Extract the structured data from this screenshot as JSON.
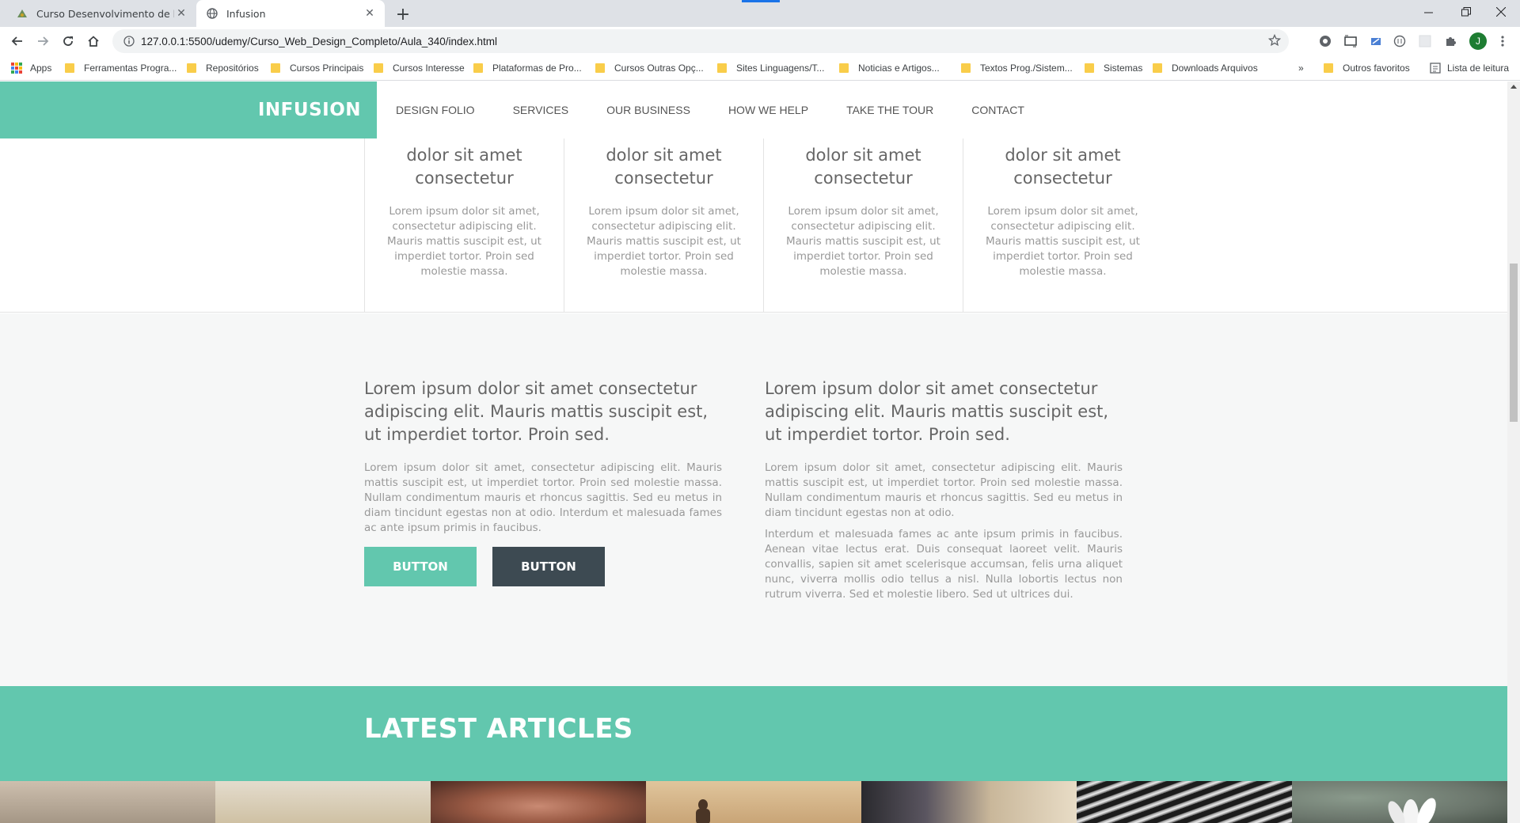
{
  "browser": {
    "tabs": [
      {
        "title": "Curso Desenvolvimento de layou",
        "active": false
      },
      {
        "title": "Infusion",
        "active": true
      }
    ],
    "url": "127.0.0.1:5500/udemy/Curso_Web_Design_Completo/Aula_340/index.html",
    "profile_initial": "J",
    "bookmarks": [
      "Apps",
      "Ferramentas Progra...",
      "Repositórios",
      "Cursos Principais",
      "Cursos Interesse",
      "Plataformas de Pro...",
      "Cursos Outras Opç...",
      "Sites Linguagens/T...",
      "Noticias e Artigos...",
      "Textos Prog./Sistem...",
      "Sistemas",
      "Downloads Arquivos"
    ],
    "bookmarks_overflow": "»",
    "other_bookmarks": "Outros favoritos",
    "reading_list": "Lista de leitura"
  },
  "site": {
    "logo": "INFUSION",
    "menu": [
      "DESIGN FOLIO",
      "SERVICES",
      "OUR BUSINESS",
      "HOW WE HELP",
      "TAKE THE TOUR",
      "CONTACT"
    ],
    "features": [
      {
        "title": "dolor sit amet consectetur",
        "text": "Lorem ipsum dolor sit amet, consectetur adipiscing elit. Mauris mattis suscipit est, ut imperdiet tortor. Proin sed molestie massa."
      },
      {
        "title": "dolor sit amet consectetur",
        "text": "Lorem ipsum dolor sit amet, consectetur adipiscing elit. Mauris mattis suscipit est, ut imperdiet tortor. Proin sed molestie massa."
      },
      {
        "title": "dolor sit amet consectetur",
        "text": "Lorem ipsum dolor sit amet, consectetur adipiscing elit. Mauris mattis suscipit est, ut imperdiet tortor. Proin sed molestie massa."
      },
      {
        "title": "dolor sit amet consectetur",
        "text": "Lorem ipsum dolor sit amet, consectetur adipiscing elit. Mauris mattis suscipit est, ut imperdiet tortor. Proin sed molestie massa."
      }
    ],
    "about_left": {
      "heading": "Lorem ipsum dolor sit amet consectetur adipiscing elit. Mauris mattis suscipit est, ut imperdiet tortor. Proin sed.",
      "paragraph": "Lorem ipsum dolor sit amet, consectetur adipiscing elit. Mauris mattis suscipit est, ut imperdiet tortor. Proin sed molestie massa. Nullam condimentum mauris et rhoncus sagittis. Sed eu metus in diam tincidunt egestas non at odio. Interdum et malesuada fames ac ante ipsum primis in faucibus.",
      "button_primary": "BUTTON",
      "button_secondary": "BUTTON"
    },
    "about_right": {
      "heading": "Lorem ipsum dolor sit amet consectetur adipiscing elit. Mauris mattis suscipit est, ut imperdiet tortor. Proin sed.",
      "paragraph1": "Lorem ipsum dolor sit amet, consectetur adipiscing elit. Mauris mattis suscipit est, ut imperdiet tortor. Proin sed molestie massa. Nullam condimentum mauris et rhoncus sagittis. Sed eu metus in diam tincidunt egestas non at odio.",
      "paragraph2": "Interdum et malesuada fames ac ante ipsum primis in faucibus. Aenean vitae lectus erat. Duis consequat laoreet velit. Mauris convallis, sapien sit amet scelerisque accumsan, felis urna aliquet nunc, viverra mollis odio tellus a nisl. Nulla lobortis lectus non rutrum viverra. Sed et molestie libero. Sed ut ultrices dui."
    },
    "articles_title": "LATEST ARTICLES"
  },
  "colors": {
    "accent": "#62c7ae",
    "dark_button": "#3d4a52"
  }
}
